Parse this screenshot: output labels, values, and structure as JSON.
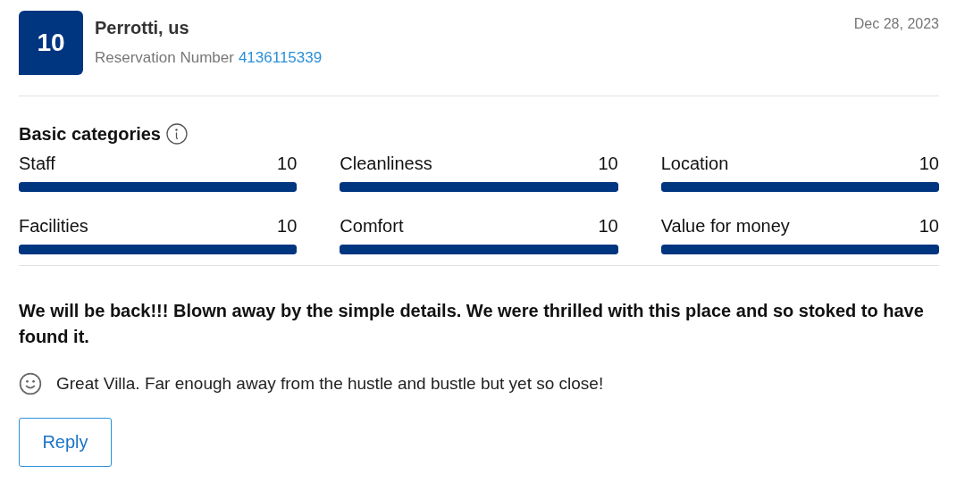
{
  "review": {
    "score": "10",
    "reviewer": "Perrotti, us",
    "reservation_label": "Reservation Number",
    "reservation_number": "4136115339",
    "date": "Dec 28, 2023"
  },
  "categories_title": "Basic categories",
  "categories": [
    {
      "name": "Staff",
      "score": "10",
      "level": 1.0
    },
    {
      "name": "Cleanliness",
      "score": "10",
      "level": 1.0
    },
    {
      "name": "Location",
      "score": "10",
      "level": 1.0
    },
    {
      "name": "Facilities",
      "score": "10",
      "level": 1.0
    },
    {
      "name": "Comfort",
      "score": "10",
      "level": 1.0
    },
    {
      "name": "Value for money",
      "score": "10",
      "level": 1.0
    }
  ],
  "headline": "We will be back!!! Blown away by the simple details. We were thrilled with this place and so stoked to have found it.",
  "positive_comment": "Great Villa. Far enough away from the hustle and bustle but yet so close!",
  "reply_button": "Reply"
}
